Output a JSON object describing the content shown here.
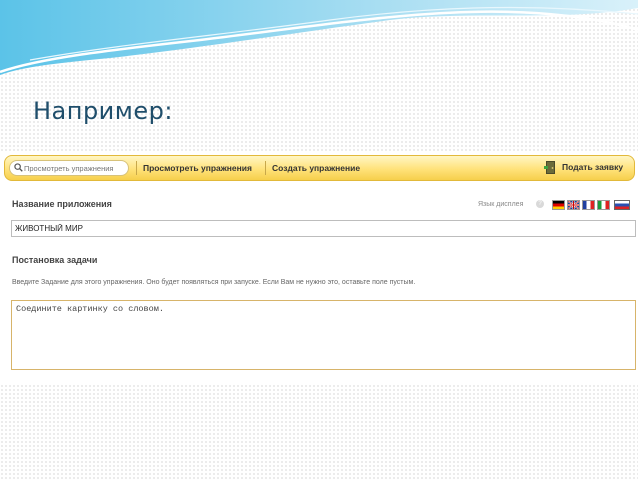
{
  "slide": {
    "title": "Например:"
  },
  "toolbar": {
    "search_placeholder": "Просмотреть упражнения",
    "view_exercises": "Просмотреть упражнения",
    "create_exercise": "Создать упражнение",
    "submit_request": "Подать заявку"
  },
  "form": {
    "app_name_label": "Название приложения",
    "display_language_label": "Язык дисплея",
    "app_name_value": "ЖИВОТНЫЙ МИР",
    "task_label": "Постановка задачи",
    "task_hint": "Введите Задание для этого упражнения. Оно будет появляться при запуске. Если Вам не нужно это, оставьте поле пустым.",
    "task_value": "Соедините картинку со словом."
  },
  "icons": {
    "search": "search-icon",
    "submit": "door-icon",
    "help": "help-icon",
    "flags": [
      "flag-de-icon",
      "flag-gb-icon",
      "flag-fr-icon",
      "flag-it-icon",
      "flag-ru-icon"
    ]
  },
  "colors": {
    "title": "#1f4e6b",
    "toolbar": "#ffe27a",
    "textarea_border": "#d7b46a"
  }
}
